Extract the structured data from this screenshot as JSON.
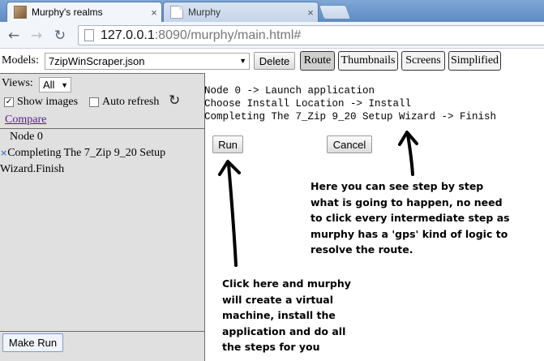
{
  "browser": {
    "tabs": [
      {
        "title": "Murphy's realms",
        "close": "×"
      },
      {
        "title": "Murphy",
        "close": "×"
      }
    ],
    "url_host": "127.0.0.1",
    "url_rest": ":8090/murphy/main.html#"
  },
  "toolbar": {
    "models_label": "Models:",
    "models_selected": "7zipWinScraper.json",
    "delete_label": "Delete",
    "route_label": "Route",
    "thumbnails_label": "Thumbnails",
    "screens_label": "Screens",
    "simplified_label": "Simplified"
  },
  "left_panel": {
    "views_label": "Views:",
    "views_selected": "All",
    "show_images_label": "Show images",
    "show_images_checked": true,
    "auto_refresh_label": "Auto refresh",
    "auto_refresh_checked": false,
    "compare_label": "Compare",
    "tree": {
      "root": "Node 0",
      "child_icon": "×",
      "child_line1": "Completing The 7_Zip 9_20 Setup",
      "child_line2": "Wizard.Finish"
    },
    "make_run_label": "Make Run"
  },
  "route": {
    "lines": [
      "Node 0 -> Launch application",
      "Choose Install Location -> Install",
      "Completing The 7_Zip 9_20 Setup Wizard -> Finish"
    ],
    "run_label": "Run",
    "cancel_label": "Cancel"
  },
  "annotations": {
    "step_by_step": [
      "Here you can see step by step",
      "what is going to happen, no need",
      "to click every intermediate step as",
      "murphy has a 'gps' kind of logic to",
      "resolve the route."
    ],
    "click_here": [
      "Click here and murphy",
      "will create a virtual",
      "machine, install the",
      "application and do all",
      "the steps for you"
    ]
  }
}
